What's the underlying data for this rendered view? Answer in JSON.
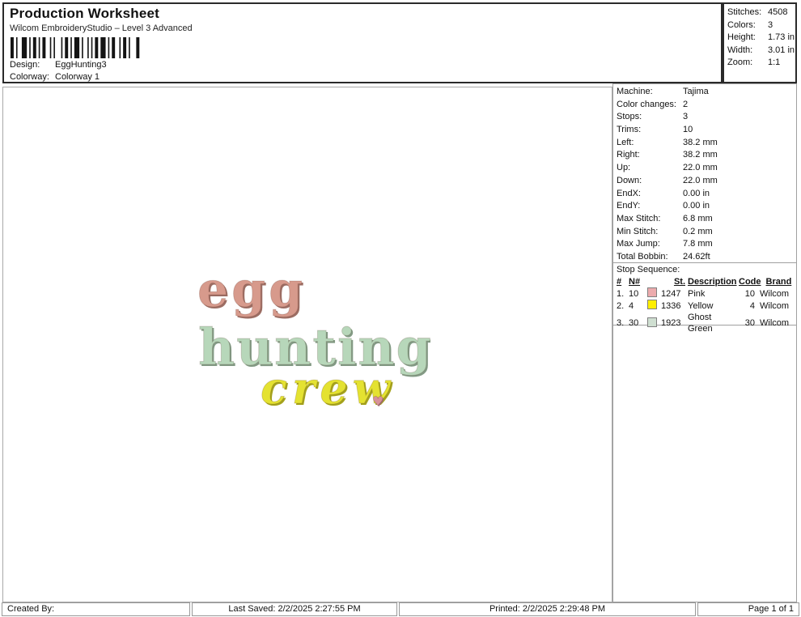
{
  "header": {
    "title": "Production Worksheet",
    "subtitle": "Wilcom EmbroideryStudio – Level 3 Advanced",
    "design_label": "Design:",
    "design_value": "EggHunting3",
    "colorway_label": "Colorway:",
    "colorway_value": "Colorway 1"
  },
  "summary": {
    "rows": [
      {
        "label": "Stitches:",
        "value": "4508"
      },
      {
        "label": "Colors:",
        "value": "3"
      },
      {
        "label": "Height:",
        "value": "1.73 in"
      },
      {
        "label": "Width:",
        "value": "3.01 in"
      },
      {
        "label": "Zoom:",
        "value": "1:1"
      }
    ]
  },
  "machine_info": {
    "rows": [
      {
        "label": "Machine:",
        "value": "Tajima"
      },
      {
        "label": "Color changes:",
        "value": "2"
      },
      {
        "label": "Stops:",
        "value": "3"
      },
      {
        "label": "Trims:",
        "value": "10"
      },
      {
        "label": "Left:",
        "value": "38.2 mm"
      },
      {
        "label": "Right:",
        "value": "38.2 mm"
      },
      {
        "label": "Up:",
        "value": "22.0 mm"
      },
      {
        "label": "Down:",
        "value": "22.0 mm"
      },
      {
        "label": "EndX:",
        "value": "0.00 in"
      },
      {
        "label": "EndY:",
        "value": "0.00 in"
      },
      {
        "label": "Max Stitch:",
        "value": "6.8 mm"
      },
      {
        "label": "Min Stitch:",
        "value": "0.2 mm"
      },
      {
        "label": "Max Jump:",
        "value": "7.8 mm"
      },
      {
        "label": "Total Bobbin:",
        "value": "24.62ft"
      }
    ]
  },
  "stop_sequence": {
    "title": "Stop Sequence:",
    "columns": [
      "#",
      "N#",
      "St.",
      "Description",
      "Code",
      "Brand"
    ],
    "rows": [
      {
        "num": "1.",
        "n": "10",
        "swatch": "#ecabad",
        "st": "1247",
        "description": "Pink",
        "code": "10",
        "brand": "Wilcom"
      },
      {
        "num": "2.",
        "n": "4",
        "swatch": "#ffef00",
        "st": "1336",
        "description": "Yellow",
        "code": "4",
        "brand": "Wilcom"
      },
      {
        "num": "3.",
        "n": "30",
        "swatch": "#cfdfd1",
        "st": "1923",
        "description": "Ghost Green",
        "code": "30",
        "brand": "Wilcom"
      }
    ]
  },
  "design": {
    "line1": "egg",
    "line2": "hunting",
    "line3": "crew",
    "heart": "♥",
    "colors": {
      "egg": "#d79a8c",
      "hunting": "#b7d7ba",
      "crew": "#e4e231",
      "heart": "#d8929a"
    }
  },
  "footer": {
    "created_by": "Created By:",
    "last_saved": "Last Saved: 2/2/2025 2:27:55 PM",
    "printed": "Printed: 2/2/2025 2:29:48 PM",
    "page": "Page 1 of 1"
  }
}
